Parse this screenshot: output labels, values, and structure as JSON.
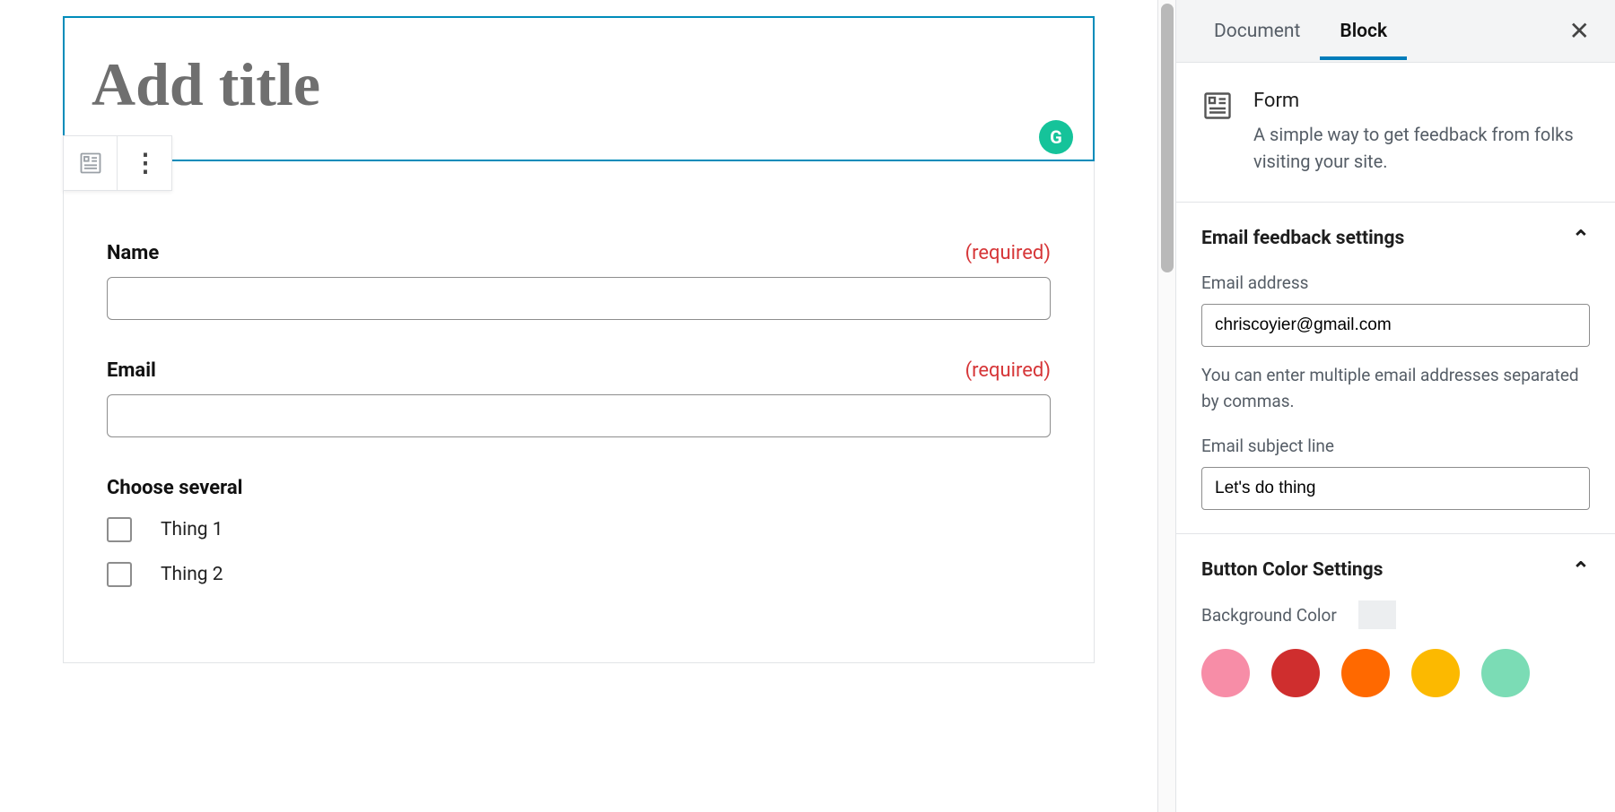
{
  "editor": {
    "title_placeholder": "Add title",
    "form": {
      "fields": [
        {
          "label": "Name",
          "required_text": "(required)"
        },
        {
          "label": "Email",
          "required_text": "(required)"
        }
      ],
      "checkbox_group": {
        "label": "Choose several",
        "options": [
          "Thing 1",
          "Thing 2"
        ]
      }
    }
  },
  "sidebar": {
    "tabs": {
      "document": "Document",
      "block": "Block"
    },
    "block_info": {
      "name": "Form",
      "description": "A simple way to get feedback from folks visiting your site."
    },
    "panels": {
      "email": {
        "title": "Email feedback settings",
        "email_label": "Email address",
        "email_value": "chriscoyier@gmail.com",
        "email_help": "You can enter multiple email addresses separated by commas.",
        "subject_label": "Email subject line",
        "subject_value": "Let's do thing"
      },
      "button_color": {
        "title": "Button Color Settings",
        "bg_label": "Background Color",
        "swatches": [
          "#f78da7",
          "#cf2e2e",
          "#ff6900",
          "#fcb900",
          "#7bdcb5"
        ]
      }
    }
  }
}
